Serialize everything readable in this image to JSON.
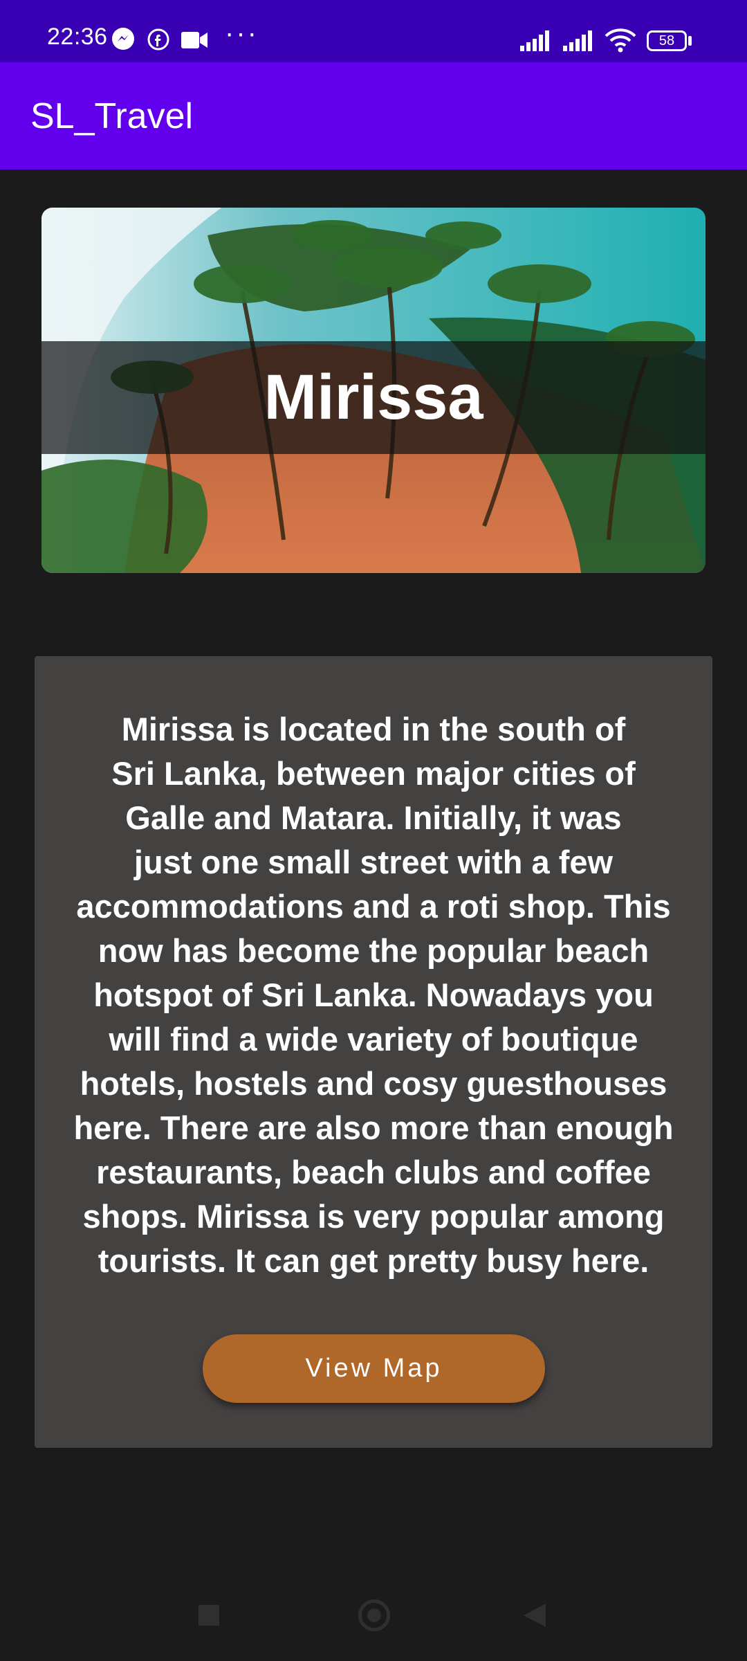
{
  "status_bar": {
    "time": "22:36",
    "more_indicator": "···",
    "battery_level": "58",
    "icons": [
      "messenger-icon",
      "facebook-icon",
      "video-camera-icon",
      "signal-icon",
      "signal-icon",
      "wifi-icon",
      "battery-icon"
    ]
  },
  "app_bar": {
    "title": "SL_Travel",
    "color": "#6200ee"
  },
  "hero": {
    "title": "Mirissa"
  },
  "info": {
    "description": "Mirissa is located in the south of\nSri Lanka, between major cities of\nGalle and Matara. Initially, it was\njust one small street with a few\naccommodations and a roti shop. This\nnow has become the popular beach\nhotspot of Sri Lanka. Nowadays you\nwill find a wide variety of boutique\nhotels, hostels and cosy guesthouses\nhere. There are also more than enough\nrestaurants, beach clubs and coffee\nshops.  Mirissa is very popular among\ntourists. It can get pretty busy here.",
    "button_label": "View Map",
    "button_color": "#b0672a"
  },
  "nav_bar": {
    "icons": [
      "recent-apps-icon",
      "home-icon",
      "back-icon"
    ]
  }
}
